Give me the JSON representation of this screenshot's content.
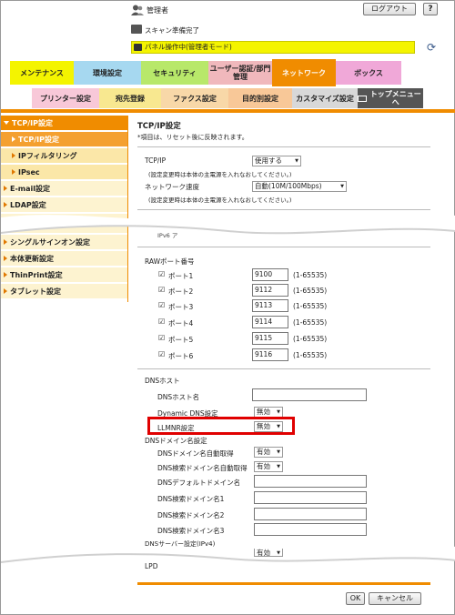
{
  "header": {
    "user_label": "管理者",
    "logout_label": "ログアウト",
    "help_label": "?",
    "scan_status": "スキャン準備完了",
    "panel_status": "パネル操作中(管理者モード)"
  },
  "main_tabs": [
    {
      "label": "メンテナンス"
    },
    {
      "label": "環境設定"
    },
    {
      "label": "セキュリティ"
    },
    {
      "label": "ユーザー認証/部門管理"
    },
    {
      "label": "ネットワーク"
    },
    {
      "label": "ボックス"
    }
  ],
  "sub_tabs": [
    {
      "label": "プリンター設定"
    },
    {
      "label": "宛先登録"
    },
    {
      "label": "ファクス設定"
    },
    {
      "label": "目的別設定"
    },
    {
      "label": "カスタマイズ設定"
    },
    {
      "label": "トップメニューへ"
    }
  ],
  "sidebar": {
    "items": [
      {
        "label": "TCP/IP設定"
      },
      {
        "label": "TCP/IP設定"
      },
      {
        "label": "IPフィルタリング"
      },
      {
        "label": "IPsec"
      },
      {
        "label": "E-mail設定"
      },
      {
        "label": "LDAP設定"
      },
      {
        "label": "シングルサインオン設定"
      },
      {
        "label": "本体更新設定"
      },
      {
        "label": "ThinPrint設定"
      },
      {
        "label": "タブレット設定"
      }
    ]
  },
  "content": {
    "title": "TCP/IP設定",
    "note": "*項目は、リセット後に反映されます。",
    "tcpip_label": "TCP/IP",
    "tcpip_value": "使用する",
    "tcpip_hint": "(設定変更時は本体の主電源を入れなおしてください。)",
    "speed_label": "ネットワーク速度",
    "speed_value": "自動(10M/100Mbps)",
    "speed_hint": "(設定変更時は本体の主電源を入れなおしてください。)",
    "ipv6_partial": "IPv6 ア",
    "raw_port_title": "RAWポート番号",
    "ports": [
      {
        "label": "ポート1",
        "value": "9100",
        "range": "(1-65535)"
      },
      {
        "label": "ポート2",
        "value": "9112",
        "range": "(1-65535)"
      },
      {
        "label": "ポート3",
        "value": "9113",
        "range": "(1-65535)"
      },
      {
        "label": "ポート4",
        "value": "9114",
        "range": "(1-65535)"
      },
      {
        "label": "ポート5",
        "value": "9115",
        "range": "(1-65535)"
      },
      {
        "label": "ポート6",
        "value": "9116",
        "range": "(1-65535)"
      }
    ],
    "dns_host_title": "DNSホスト",
    "dns_host_name_label": "DNSホスト名",
    "dynamic_dns_label": "Dynamic DNS設定",
    "dynamic_dns_value": "無効",
    "llmnr_label": "LLMNR設定",
    "llmnr_value": "無効",
    "dns_domain_title": "DNSドメイン名設定",
    "auto_get_label": "DNSドメイン名自動取得",
    "auto_get_value": "有効",
    "search_auto_label": "DNS検索ドメイン名自動取得",
    "search_auto_value": "有効",
    "default_domain_label": "DNSデフォルトドメイン名",
    "search1_label": "DNS検索ドメイン名1",
    "search2_label": "DNS検索ドメイン名2",
    "search3_label": "DNS検索ドメイン名3",
    "dns_server_partial": "DNSサーバー設定(IPv4)",
    "partial_select": "有効",
    "lpd_label": "LPD"
  },
  "footer": {
    "ok_label": "OK",
    "cancel_label": "キャンセル"
  },
  "colors": {
    "accent_orange": "#f08c00",
    "highlight_red": "#e00000",
    "panel_yellow": "#f4f400"
  }
}
